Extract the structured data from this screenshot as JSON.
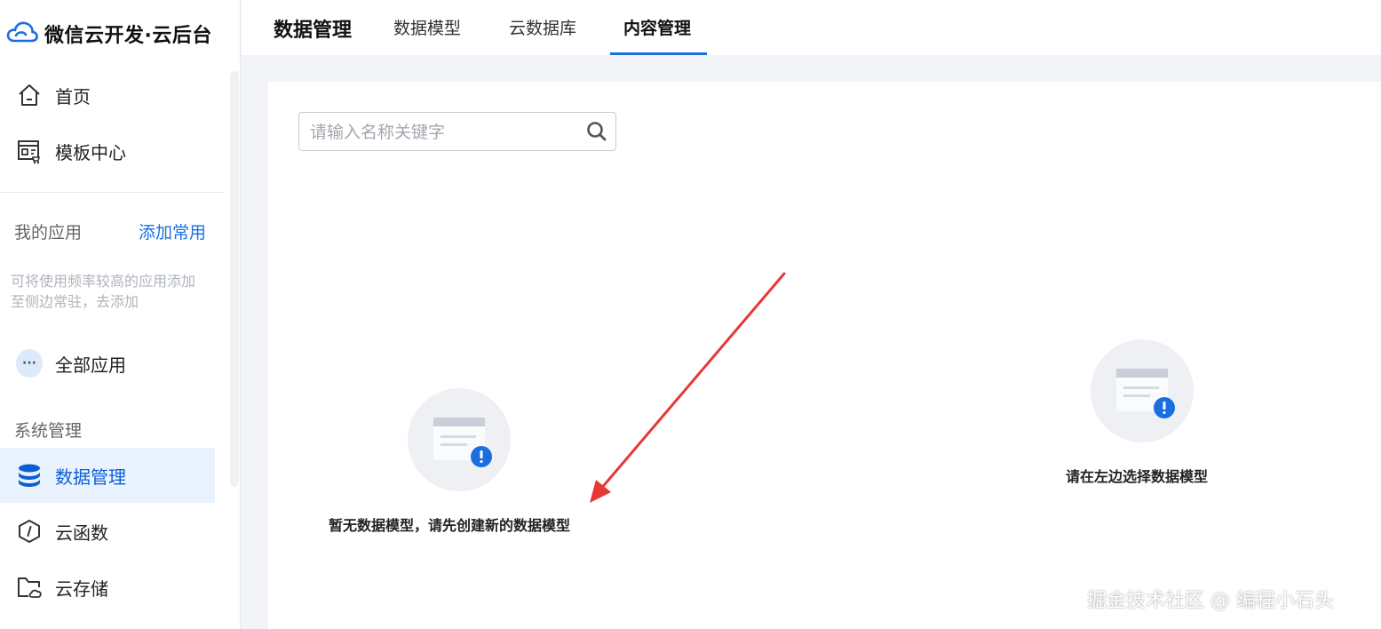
{
  "brand": {
    "name": "微信云开发·云后台",
    "accent": "#1a6fe0"
  },
  "sidebar": {
    "items": [
      {
        "label": "首页",
        "icon": "home-icon"
      },
      {
        "label": "模板中心",
        "icon": "template-store-icon"
      }
    ],
    "my_apps": {
      "label": "我的应用",
      "add_label": "添加常用",
      "hint": "可将使用频率较高的应用添加至侧边常驻，去添加",
      "all_apps": "全部应用",
      "all_apps_icon_text": "···"
    },
    "system": {
      "label": "系统管理",
      "items": [
        {
          "label": "数据管理",
          "icon": "database-icon",
          "active": true
        },
        {
          "label": "云函数",
          "icon": "cloud-function-icon"
        },
        {
          "label": "云存储",
          "icon": "cloud-storage-icon"
        }
      ]
    }
  },
  "topbar": {
    "title": "数据管理",
    "tabs": [
      {
        "label": "数据模型"
      },
      {
        "label": "云数据库"
      },
      {
        "label": "内容管理",
        "active": true
      }
    ]
  },
  "search": {
    "placeholder": "请输入名称关键字",
    "value": ""
  },
  "empty_left": {
    "text": "暂无数据模型，请先创建新的数据模型"
  },
  "empty_right": {
    "text": "请在左边选择数据模型"
  },
  "watermark": "掘金技术社区 @ 编程小石头",
  "colors": {
    "active_bg": "#eaf2fd",
    "active_text": "#0b5fd6",
    "annotation_arrow": "#e53935",
    "badge": "#1a6fe0"
  }
}
